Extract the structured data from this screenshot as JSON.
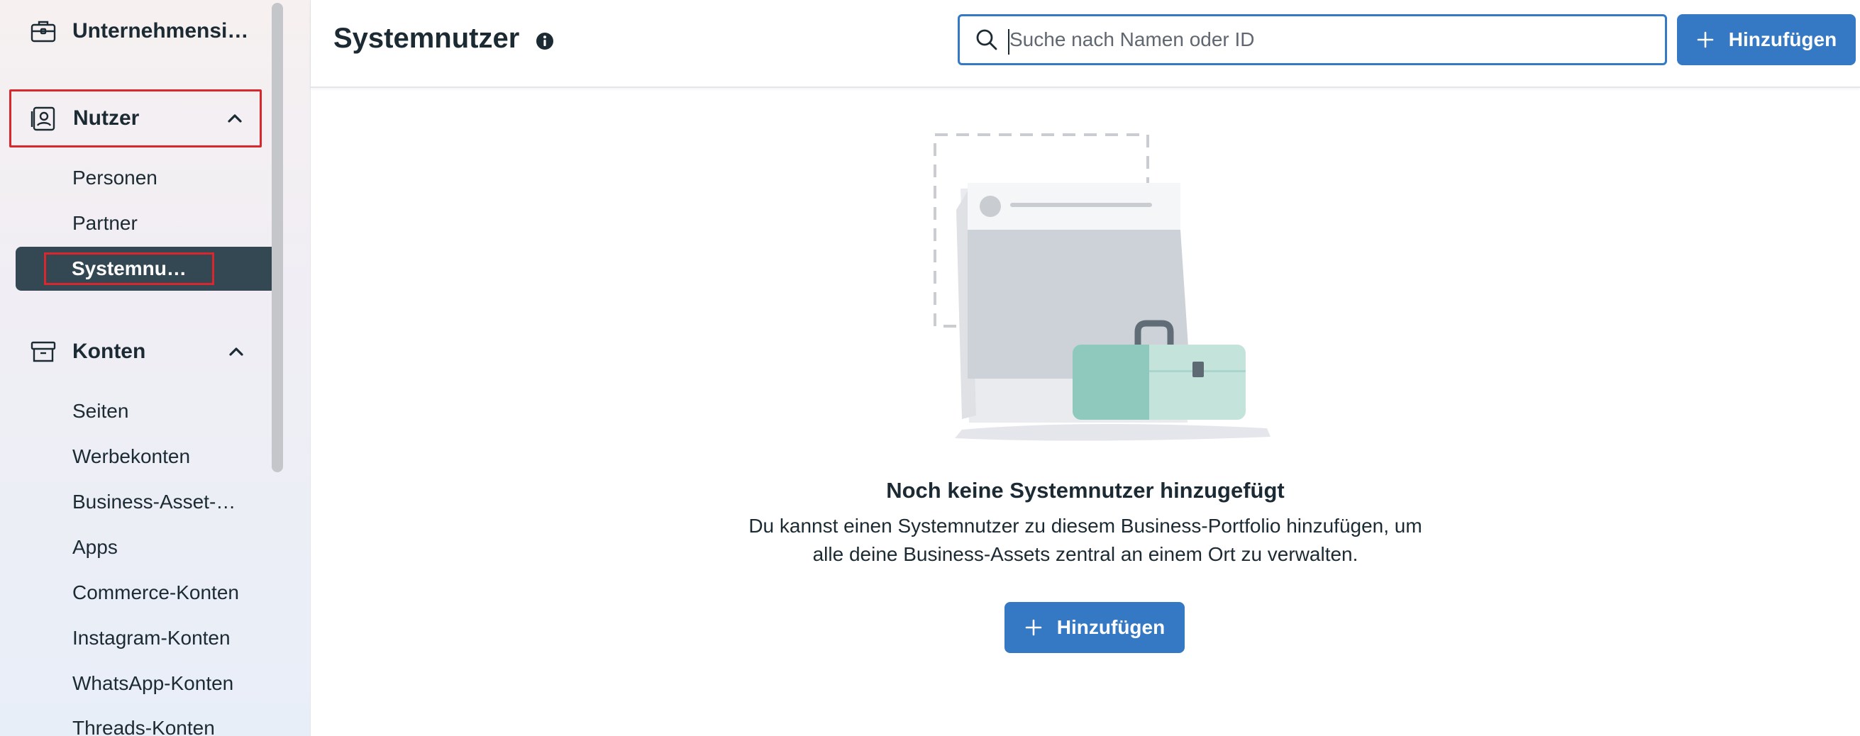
{
  "sidebar": {
    "sections": {
      "company": {
        "label": "Unternehmensi…",
        "icon": "briefcase-icon"
      },
      "users": {
        "label": "Nutzer",
        "icon": "id-badge-icon",
        "expanded": true
      },
      "accounts": {
        "label": "Konten",
        "icon": "archive-box-icon",
        "expanded": true
      }
    },
    "users_items": [
      {
        "label": "Personen"
      },
      {
        "label": "Partner"
      },
      {
        "label": "Systemnutzer",
        "active": true
      }
    ],
    "accounts_items": [
      {
        "label": "Seiten"
      },
      {
        "label": "Werbekonten"
      },
      {
        "label": "Business-Asset-…"
      },
      {
        "label": "Apps"
      },
      {
        "label": "Commerce-Konten"
      },
      {
        "label": "Instagram-Konten"
      },
      {
        "label": "WhatsApp-Konten"
      },
      {
        "label": "Threads-Konten"
      }
    ]
  },
  "header": {
    "title": "Systemnutzer",
    "search_placeholder": "Suche nach Namen oder ID",
    "add_label": "Hinzufügen"
  },
  "empty_state": {
    "title": "Noch keine Systemnutzer hinzugefügt",
    "description": "Du kannst einen Systemnutzer zu diesem Business-Portfolio hinzufügen, um alle deine Business-Assets zentral an einem Ort zu verwalten.",
    "add_label": "Hinzufügen"
  },
  "colors": {
    "primary": "#3578c3",
    "active_nav": "#344854",
    "highlight": "#d9272e",
    "text": "#1c2b33",
    "accent_green": "#8fc9bd"
  }
}
